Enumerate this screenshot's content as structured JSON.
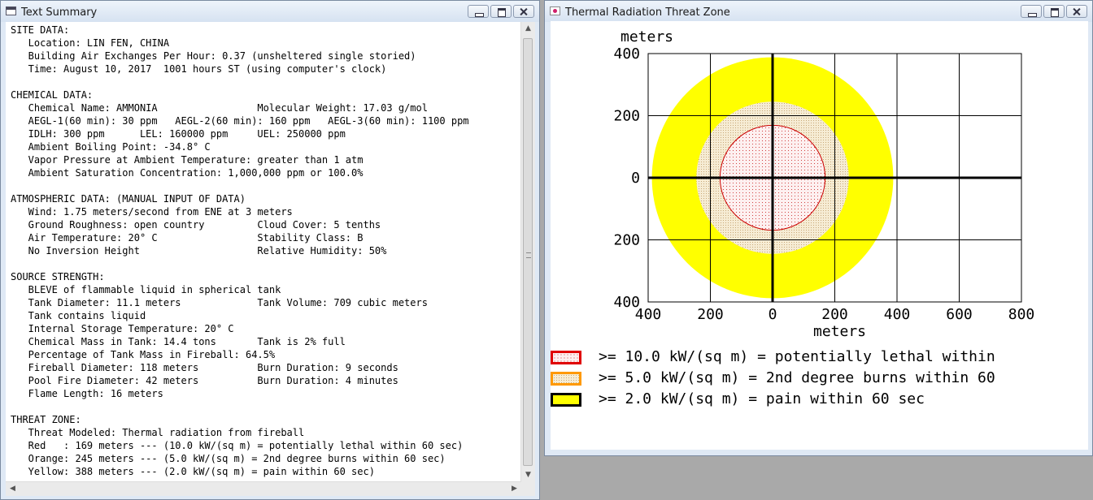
{
  "left_window": {
    "title": "Text Summary",
    "lines": [
      "SITE DATA:",
      "   Location: LIN FEN, CHINA",
      "   Building Air Exchanges Per Hour: 0.37 (unsheltered single storied)",
      "   Time: August 10, 2017  1001 hours ST (using computer's clock)",
      "",
      "CHEMICAL DATA:",
      "   Chemical Name: AMMONIA                 Molecular Weight: 17.03 g/mol",
      "   AEGL-1(60 min): 30 ppm   AEGL-2(60 min): 160 ppm   AEGL-3(60 min): 1100 ppm",
      "   IDLH: 300 ppm      LEL: 160000 ppm     UEL: 250000 ppm",
      "   Ambient Boiling Point: -34.8° C",
      "   Vapor Pressure at Ambient Temperature: greater than 1 atm",
      "   Ambient Saturation Concentration: 1,000,000 ppm or 100.0%",
      "",
      "ATMOSPHERIC DATA: (MANUAL INPUT OF DATA)",
      "   Wind: 1.75 meters/second from ENE at 3 meters",
      "   Ground Roughness: open country         Cloud Cover: 5 tenths",
      "   Air Temperature: 20° C                 Stability Class: B",
      "   No Inversion Height                    Relative Humidity: 50%",
      "",
      "SOURCE STRENGTH:",
      "   BLEVE of flammable liquid in spherical tank",
      "   Tank Diameter: 11.1 meters             Tank Volume: 709 cubic meters",
      "   Tank contains liquid",
      "   Internal Storage Temperature: 20° C",
      "   Chemical Mass in Tank: 14.4 tons       Tank is 2% full",
      "   Percentage of Tank Mass in Fireball: 64.5%",
      "   Fireball Diameter: 118 meters          Burn Duration: 9 seconds",
      "   Pool Fire Diameter: 42 meters          Burn Duration: 4 minutes",
      "   Flame Length: 16 meters",
      "",
      "THREAT ZONE:",
      "   Threat Modeled: Thermal radiation from fireball",
      "   Red   : 169 meters --- (10.0 kW/(sq m) = potentially lethal within 60 sec)",
      "   Orange: 245 meters --- (5.0 kW/(sq m) = 2nd degree burns within 60 sec)",
      "   Yellow: 388 meters --- (2.0 kW/(sq m) = pain within 60 sec)"
    ]
  },
  "right_window": {
    "title": "Thermal Radiation Threat Zone",
    "legend": [
      {
        "text": ">= 10.0 kW/(sq m) = potentially lethal within",
        "border": "#e00000",
        "fill": "pattern-red-dots"
      },
      {
        "text": ">= 5.0 kW/(sq m) = 2nd degree burns within 60",
        "border": "#ff9900",
        "fill": "pattern-orange-dots"
      },
      {
        "text": ">= 2.0 kW/(sq m) = pain within 60 sec",
        "border": "#000000",
        "fill": "#ffff00"
      }
    ]
  },
  "chart_data": {
    "type": "area",
    "title": "",
    "ylabel": "meters",
    "xlabel": "meters",
    "x_ticks": [
      "400",
      "200",
      "0",
      "200",
      "400",
      "600",
      "800"
    ],
    "y_ticks": [
      "400",
      "200",
      "0",
      "200",
      "400"
    ],
    "xlim": [
      -400,
      800
    ],
    "ylim": [
      -400,
      400
    ],
    "grid": true,
    "zones": [
      {
        "name": "Yellow",
        "radius": 388,
        "color": "#ffff00"
      },
      {
        "name": "Orange",
        "radius": 245,
        "color": "#f5e6c8"
      },
      {
        "name": "Red",
        "radius": 169,
        "color": "#fde8e8"
      }
    ]
  }
}
